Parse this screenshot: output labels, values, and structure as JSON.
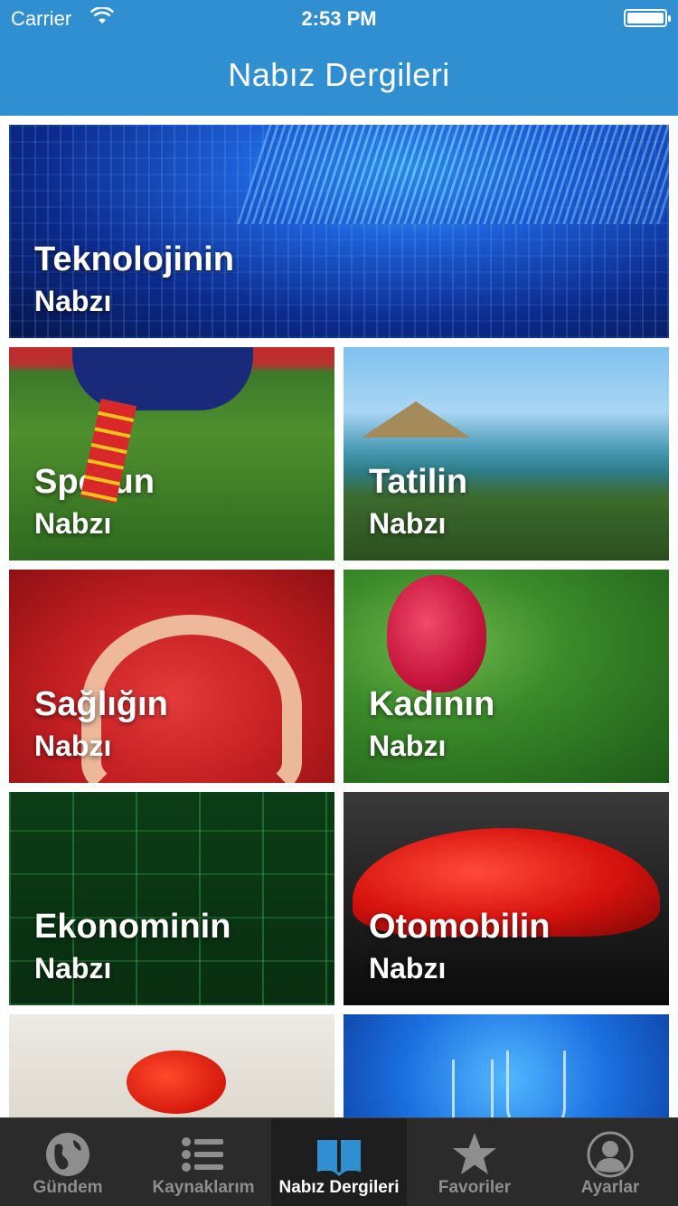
{
  "status_bar": {
    "carrier": "Carrier",
    "time": "2:53 PM"
  },
  "header": {
    "title": "Nabız Dergileri"
  },
  "cards": [
    {
      "title": "Teknolojinin",
      "subtitle": "Nabzı"
    },
    {
      "title": "Sporun",
      "subtitle": "Nabzı"
    },
    {
      "title": "Tatilin",
      "subtitle": "Nabzı"
    },
    {
      "title": "Sağlığın",
      "subtitle": "Nabzı"
    },
    {
      "title": "Kadının",
      "subtitle": "Nabzı"
    },
    {
      "title": "Ekonominin",
      "subtitle": "Nabzı"
    },
    {
      "title": "Otomobilin",
      "subtitle": "Nabzı"
    }
  ],
  "tabbar": {
    "items": [
      {
        "label": "Gündem",
        "icon": "globe-icon"
      },
      {
        "label": "Kaynaklarım",
        "icon": "list-icon"
      },
      {
        "label": "Nabız Dergileri",
        "icon": "book-icon",
        "active": true
      },
      {
        "label": "Favoriler",
        "icon": "star-icon"
      },
      {
        "label": "Ayarlar",
        "icon": "user-icon"
      }
    ]
  },
  "colors": {
    "header": "#2f8fd0",
    "tabbar": "#2b2b2b",
    "tab_active_icon": "#2f8fd0",
    "tab_inactive": "#8e8e8e"
  }
}
